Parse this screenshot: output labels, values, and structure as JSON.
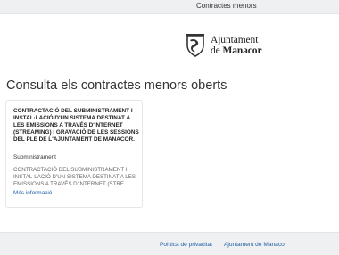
{
  "topbar": {
    "nav_label": "Contractes menors"
  },
  "logo": {
    "line1": "Ajuntament",
    "line2_prefix": "de",
    "line2_name": "Manacor"
  },
  "main": {
    "title": "Consulta els contractes menors oberts",
    "cards": [
      {
        "title": "CONTRACTACIÓ DEL SUBMINISTRAMENT I INSTAL·LACIÓ D'UN SISTEMA DESTINAT A LES EMISSIONS A TRAVÉS D'INTERNET (STREAMING) I GRAVACIÓ DE LES SESSIONS DEL PLE DE L'AJUNTAMENT DE MANACOR.",
        "type": "Subministrament",
        "description": "CONTRACTACIÓ DEL SUBMINISTRAMENT I INSTAL·LACIÓ D'UN SISTEMA DESTINAT A LES EMISSIONS A TRAVÉS D'INTERNET (STRE...",
        "more_link": "Més informació"
      }
    ]
  },
  "footer": {
    "privacy_link": "Política de privacitat",
    "council_link": "Ajuntament de Manacor"
  },
  "colors": {
    "link": "#1f5fa8",
    "bar_background": "#eef0f2"
  },
  "icons": {
    "logo_emblem": "coat-of-arms-icon"
  }
}
